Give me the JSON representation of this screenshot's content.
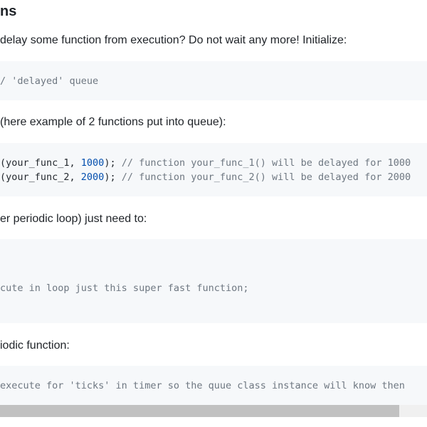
{
  "section": {
    "heading": "ns"
  },
  "paragraphs": {
    "intro": "delay some function from execution? Do not wait any more! Initialize:",
    "example": "(here example of 2 functions put into queue):",
    "loop": "er periodic loop) just need to:",
    "periodic": "iodic function:"
  },
  "code_blocks": {
    "init": {
      "line1": {
        "comment": "/ 'delayed' queue"
      }
    },
    "queue": {
      "line1": {
        "pre": "(your_func_1, ",
        "num": "1000",
        "mid": "); ",
        "comment": "// function your_func_1() will be delayed for 1000"
      },
      "line2": {
        "pre": "(your_func_2, ",
        "num": "2000",
        "mid": "); ",
        "comment": "// function your_func_2() will be delayed for 2000"
      }
    },
    "loop": {
      "line1": {
        "comment": "cute in loop just this super fast function;"
      }
    },
    "periodic": {
      "line1": {
        "comment": "execute for 'ticks' in timer so the quue class instance will know then"
      }
    }
  },
  "colors": {
    "text": "#1f2328",
    "code_background": "#f6f8fa",
    "comment": "#6e7781",
    "number": "#0550ae",
    "scrollbar_thumb": "#c1c1c1",
    "scrollbar_track": "#f0f0f0"
  }
}
